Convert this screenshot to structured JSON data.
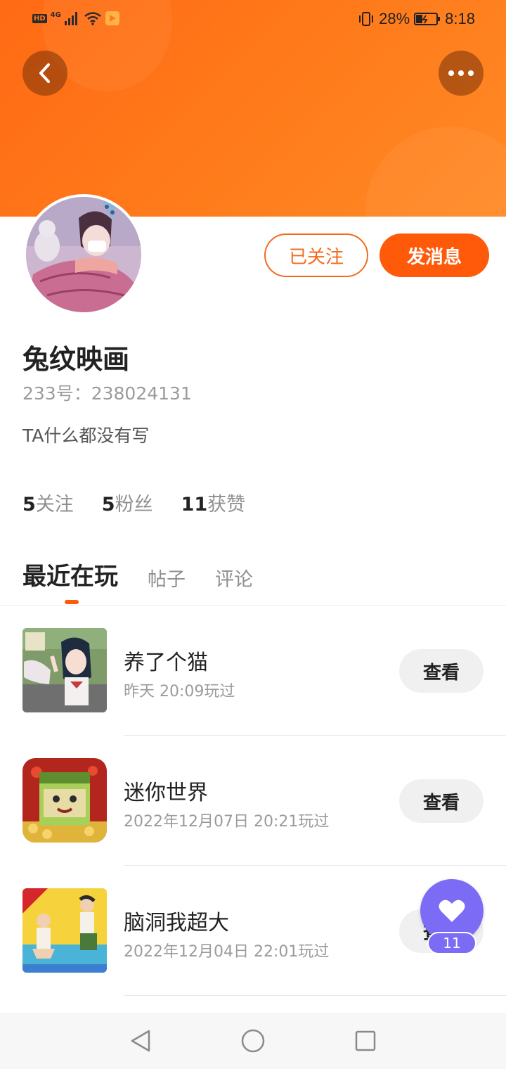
{
  "status_bar": {
    "hd": "HD",
    "network": "4G",
    "battery_percent": "28%",
    "time": "8:18"
  },
  "header": {
    "back_icon": "chevron-left-icon",
    "more_icon": "more-dots-icon"
  },
  "profile": {
    "username": "兔纹映画",
    "uid_line": "233号：238024131",
    "bio": "TA什么都没有写",
    "follow_label": "已关注",
    "message_label": "发消息",
    "stats": [
      {
        "count": "5",
        "label": "关注"
      },
      {
        "count": "5",
        "label": "粉丝"
      },
      {
        "count": "11",
        "label": "获赞"
      }
    ]
  },
  "tabs": [
    {
      "label": "最近在玩",
      "active": true
    },
    {
      "label": "帖子",
      "active": false
    },
    {
      "label": "评论",
      "active": false
    }
  ],
  "games": [
    {
      "name": "养了个猫",
      "time": "昨天 20:09玩过",
      "button": "查看"
    },
    {
      "name": "迷你世界",
      "time": "2022年12月07日 20:21玩过",
      "button": "查看"
    },
    {
      "name": "脑洞我超大",
      "time": "2022年12月04日 22:01玩过",
      "button": "查看"
    }
  ],
  "floating_like": {
    "icon": "heart-icon",
    "count": "11"
  },
  "colors": {
    "accent": "#ff5a0a",
    "banner": "#ff7a1a",
    "like_bubble": "#7c6cf5"
  }
}
